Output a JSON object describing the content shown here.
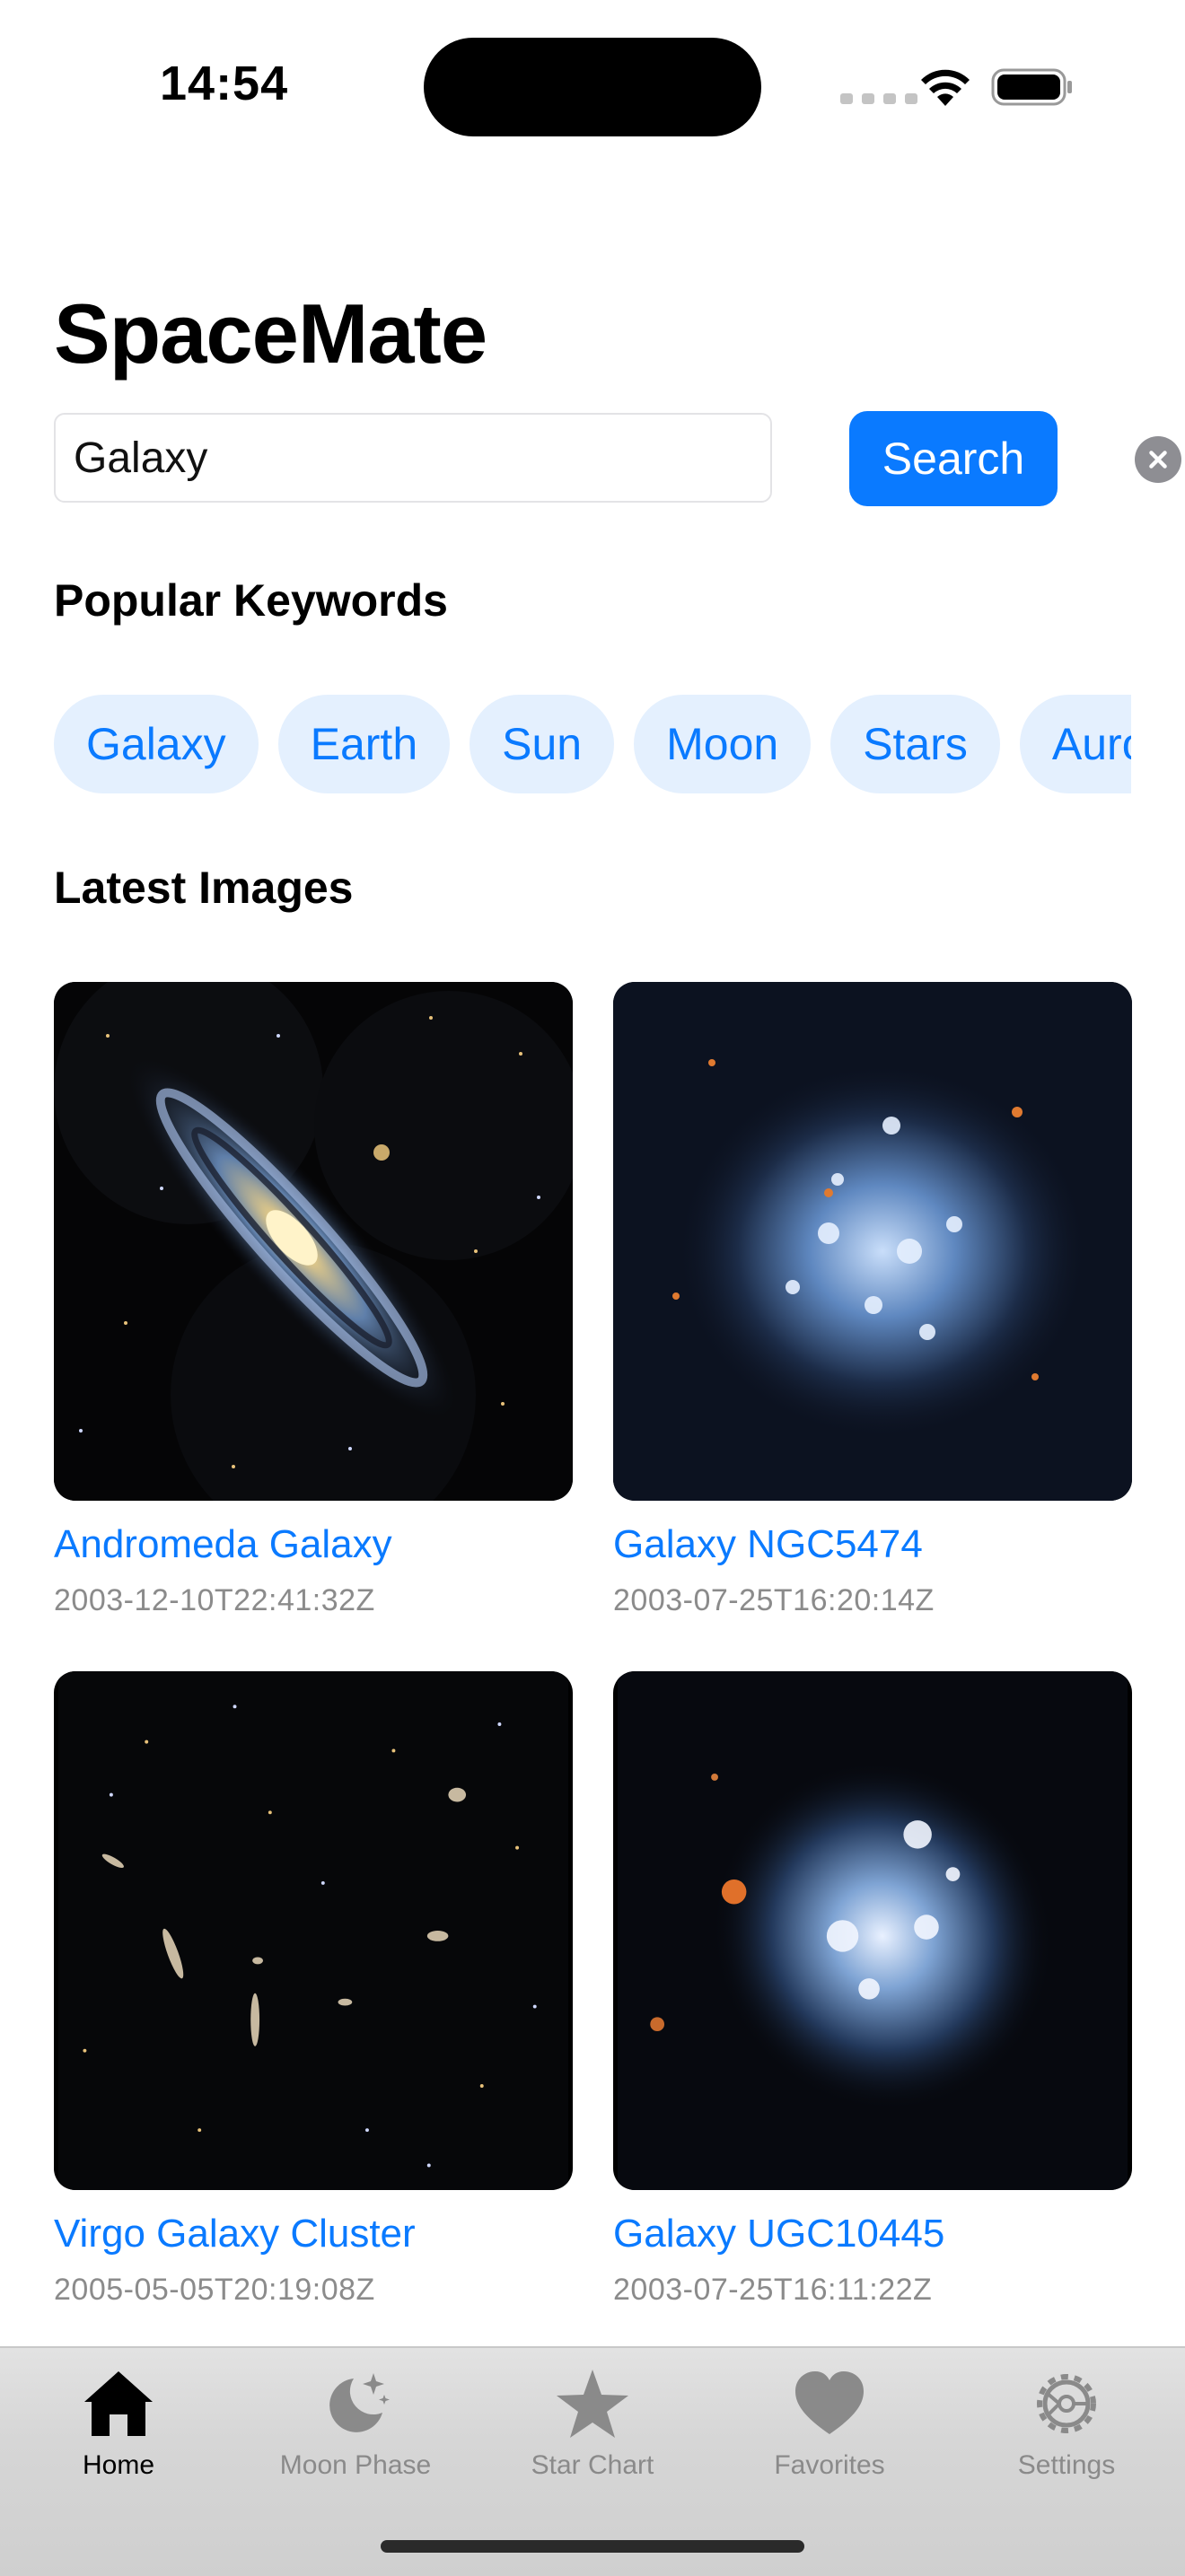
{
  "status_bar": {
    "time": "14:54"
  },
  "app": {
    "title": "SpaceMate"
  },
  "search": {
    "value": "Galaxy",
    "button_label": "Search"
  },
  "popular": {
    "title": "Popular Keywords",
    "keywords": [
      "Galaxy",
      "Earth",
      "Sun",
      "Moon",
      "Stars",
      "Aurora"
    ]
  },
  "latest": {
    "title": "Latest Images",
    "items": [
      {
        "title": "Andromeda Galaxy",
        "date": "2003-12-10T22:41:32Z"
      },
      {
        "title": "Galaxy NGC5474",
        "date": "2003-07-25T16:20:14Z"
      },
      {
        "title": "Virgo Galaxy Cluster",
        "date": "2005-05-05T20:19:08Z"
      },
      {
        "title": "Galaxy UGC10445",
        "date": "2003-07-25T16:11:22Z"
      }
    ]
  },
  "tabs": [
    {
      "label": "Home",
      "icon": "house-icon",
      "active": true
    },
    {
      "label": "Moon Phase",
      "icon": "moon-stars-icon",
      "active": false
    },
    {
      "label": "Star Chart",
      "icon": "star-icon",
      "active": false
    },
    {
      "label": "Favorites",
      "icon": "heart-icon",
      "active": false
    },
    {
      "label": "Settings",
      "icon": "gear-icon",
      "active": false
    }
  ],
  "colors": {
    "accent": "#0a7aff",
    "chip_background": "#e4f0fe",
    "date_text": "#8b8b8b"
  }
}
